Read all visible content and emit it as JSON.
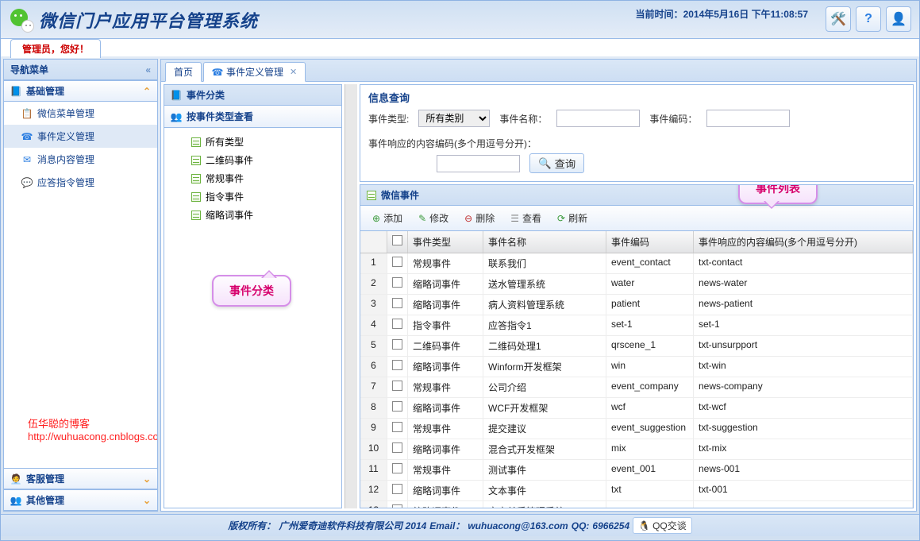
{
  "app_title": "微信门户应用平台管理系统",
  "time_label": "当前时间：",
  "time_value": "2014年5月16日 下午11:08:57",
  "admin_greeting": "管理员，您好！",
  "sidebar": {
    "title": "导航菜单",
    "groups": [
      {
        "label": "基础管理",
        "expanded": true
      },
      {
        "label": "客服管理",
        "expanded": false
      },
      {
        "label": "其他管理",
        "expanded": false
      }
    ],
    "items": [
      {
        "label": "微信菜单管理",
        "icon": "menu-icon"
      },
      {
        "label": "事件定义管理",
        "icon": "event-icon",
        "active": true
      },
      {
        "label": "消息内容管理",
        "icon": "message-icon"
      },
      {
        "label": "应答指令管理",
        "icon": "command-icon"
      }
    ]
  },
  "tabs": [
    {
      "label": "首页",
      "closable": false
    },
    {
      "label": "事件定义管理",
      "closable": true
    }
  ],
  "tree": {
    "title": "事件分类",
    "group_label": "按事件类型查看",
    "items": [
      "所有类型",
      "二维码事件",
      "常规事件",
      "指令事件",
      "缩略词事件"
    ]
  },
  "search": {
    "title": "信息查询",
    "type_label": "事件类型:",
    "type_value": "所有类别",
    "name_label": "事件名称：",
    "code_label": "事件编码：",
    "resp_label": "事件响应的内容编码(多个用逗号分开)：",
    "button": "查询"
  },
  "grid": {
    "title": "微信事件",
    "toolbar": {
      "add": "添加",
      "edit": "修改",
      "del": "删除",
      "view": "查看",
      "refresh": "刷新"
    },
    "columns": [
      "事件类型",
      "事件名称",
      "事件编码",
      "事件响应的内容编码(多个用逗号分开)"
    ],
    "rows": [
      {
        "n": 1,
        "type": "常规事件",
        "name": "联系我们",
        "code": "event_contact",
        "resp": "txt-contact"
      },
      {
        "n": 2,
        "type": "缩略词事件",
        "name": "送水管理系统",
        "code": "water",
        "resp": "news-water"
      },
      {
        "n": 3,
        "type": "缩略词事件",
        "name": "病人资料管理系统",
        "code": "patient",
        "resp": "news-patient"
      },
      {
        "n": 4,
        "type": "指令事件",
        "name": "应答指令1",
        "code": "set-1",
        "resp": "set-1"
      },
      {
        "n": 5,
        "type": "二维码事件",
        "name": "二维码处理1",
        "code": "qrscene_1",
        "resp": "txt-unsurpport"
      },
      {
        "n": 6,
        "type": "缩略词事件",
        "name": "Winform开发框架",
        "code": "win",
        "resp": "txt-win"
      },
      {
        "n": 7,
        "type": "常规事件",
        "name": "公司介绍",
        "code": "event_company",
        "resp": "news-company"
      },
      {
        "n": 8,
        "type": "缩略词事件",
        "name": "WCF开发框架",
        "code": "wcf",
        "resp": "txt-wcf"
      },
      {
        "n": 9,
        "type": "常规事件",
        "name": "提交建议",
        "code": "event_suggestion",
        "resp": "txt-suggestion"
      },
      {
        "n": 10,
        "type": "缩略词事件",
        "name": "混合式开发框架",
        "code": "mix",
        "resp": "txt-mix"
      },
      {
        "n": 11,
        "type": "常规事件",
        "name": "测试事件",
        "code": "event_001",
        "resp": "news-001"
      },
      {
        "n": 12,
        "type": "缩略词事件",
        "name": "文本事件",
        "code": "txt",
        "resp": "txt-001"
      },
      {
        "n": 13,
        "type": "缩略词事件",
        "name": "客户关系管理系统",
        "code": "crm",
        "resp": "news-crm"
      }
    ]
  },
  "callouts": {
    "tree": "事件分类",
    "list": "事件列表"
  },
  "footer": {
    "copyright_label": "版权所有：",
    "company": "广州爱奇迪软件科技有限公司 2014",
    "email_label": "Email：",
    "email": "wuhuacong@163.com",
    "qq_label": "QQ:",
    "qq": "6966254",
    "qq_chat": "QQ交谈"
  },
  "watermark": "伍华聪的博客 http://wuhuacong.cnblogs.com"
}
